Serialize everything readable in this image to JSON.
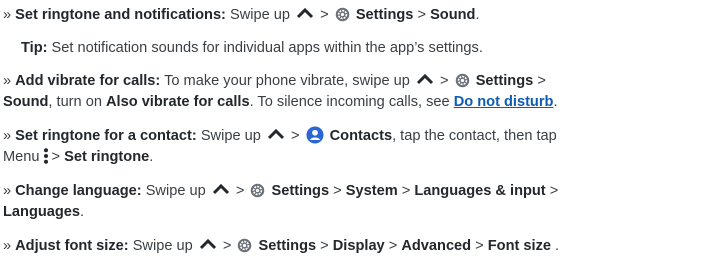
{
  "items": [
    {
      "bullet": "»",
      "title": "Set ringtone and notifications:",
      "t1": "Swipe up",
      "sep": ">",
      "settings": "Settings",
      "sep2": ">",
      "sound": "Sound",
      "end": "."
    },
    {
      "tip_label": "Tip:",
      "tip_text": "Set notification sounds for individual apps within the app’s settings."
    },
    {
      "bullet": "»",
      "title": "Add vibrate for calls:",
      "t1": "To make your phone vibrate, swipe up",
      "sep": ">",
      "settings": "Settings",
      "sep2": ">",
      "sound": "Sound",
      "t2": ", turn on",
      "also": "Also vibrate for calls",
      "t3": ". To silence incoming calls, see",
      "link": "Do not disturb",
      "end": "."
    },
    {
      "bullet": "»",
      "title": "Set ringtone for a contact:",
      "t1": "Swipe up",
      "sep": ">",
      "contacts": "Contacts",
      "t2": ", tap the contact, then tap",
      "menu": "Menu",
      "sep2": ">",
      "set_ringtone": "Set ringtone",
      "end": "."
    },
    {
      "bullet": "»",
      "title": "Change language:",
      "t1": "Swipe up",
      "sep": ">",
      "settings": "Settings",
      "sep2": ">",
      "system": "System",
      "sep3": ">",
      "lang_input": "Languages & input",
      "sep4": ">",
      "languages": "Languages",
      "end": "."
    },
    {
      "bullet": "»",
      "title": "Adjust font size:",
      "t1": "Swipe up",
      "sep": ">",
      "settings": "Settings",
      "sep2": ">",
      "display": "Display",
      "sep3": ">",
      "advanced": "Advanced",
      "sep4": ">",
      "font_size": "Font size",
      "end": " ."
    }
  ],
  "icons": {
    "caret": "chevron-up-icon",
    "gear": "settings-gear-icon",
    "contacts": "contacts-person-icon",
    "menu": "menu-dots-icon"
  },
  "colors": {
    "text": "#3a3f44",
    "bold": "#23282d",
    "link": "#0f5cb3"
  }
}
